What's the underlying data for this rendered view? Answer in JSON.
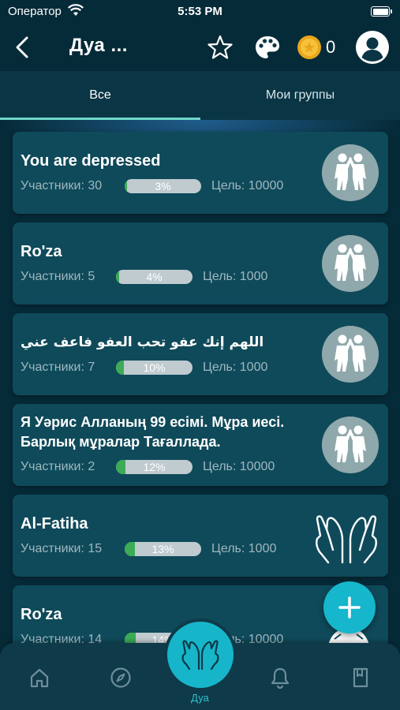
{
  "status_bar": {
    "carrier": "Оператор",
    "time": "5:53 PM"
  },
  "nav": {
    "title": "Дуа ...",
    "coins": "0"
  },
  "tabs": [
    {
      "label": "Все"
    },
    {
      "label": "Мои группы"
    }
  ],
  "groups": [
    {
      "title": "You are depressed",
      "participants": "Участники: 30",
      "progress": "3%",
      "progress_value": 3,
      "goal": "Цель: 10000",
      "icon": "people-icon"
    },
    {
      "title": "Ro'za",
      "participants": "Участники: 5",
      "progress": "4%",
      "progress_value": 4,
      "goal": "Цель: 1000",
      "icon": "people-icon"
    },
    {
      "title": "اللهم إنك عفو تحب العفو فاعف عني",
      "participants": "Участники: 7",
      "progress": "10%",
      "progress_value": 10,
      "goal": "Цель: 1000",
      "icon": "people-icon"
    },
    {
      "title": " Я Уәрис Алланың 99 есімі. Мұра иесі. Барлық мұралар Тағаллада.",
      "participants": "Участники: 2",
      "progress": "12%",
      "progress_value": 12,
      "goal": "Цель: 10000",
      "icon": "people-icon"
    },
    {
      "title": "Al-Fatiha",
      "participants": "Участники: 15",
      "progress": "13%",
      "progress_value": 13,
      "goal": "Цель: 1000",
      "icon": "praying-hands-icon"
    },
    {
      "title": "Ro'za",
      "participants": "Участники: 14",
      "progress": "14%",
      "progress_value": 14,
      "goal": "Цель: 10000",
      "icon": "person-icon"
    }
  ],
  "tab_bar": {
    "active_label": "Дуа"
  },
  "colors": {
    "accent": "#16b6cc",
    "progress": "#3cab55",
    "card": "#0f4a5a",
    "background": "#062b38"
  }
}
